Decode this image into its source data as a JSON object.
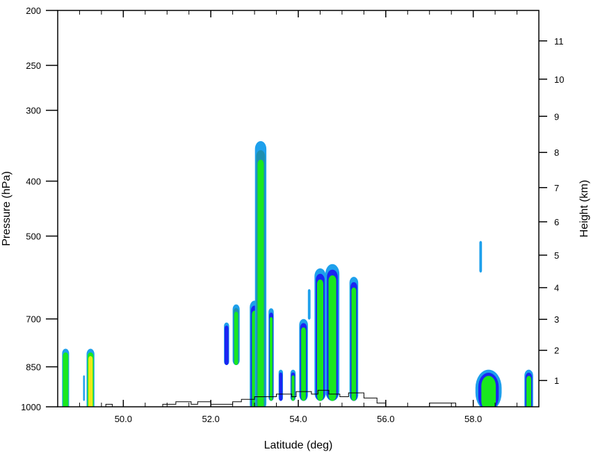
{
  "chart_data": {
    "type": "contour",
    "title": "",
    "xlabel": "Latitude (deg)",
    "ylabel_left": "Pressure (hPa)",
    "ylabel_right": "Height (km)",
    "xlim": [
      48.5,
      59.5
    ],
    "ylim_pressure": [
      1000,
      200
    ],
    "pressure_scale": "log",
    "x_ticks": [
      "50.0",
      "52.0",
      "54.0",
      "56.0",
      "58.0"
    ],
    "x_tick_values": [
      50,
      52,
      54,
      56,
      58
    ],
    "left_ticks": [
      "200",
      "250",
      "300",
      "400",
      "500",
      "700",
      "850",
      "1000"
    ],
    "left_tick_values": [
      200,
      250,
      300,
      400,
      500,
      700,
      850,
      1000
    ],
    "right_ticks": [
      "1",
      "2",
      "3",
      "4",
      "5",
      "6",
      "7",
      "8",
      "9",
      "10",
      "11"
    ],
    "right_tick_values": [
      1,
      2,
      3,
      4,
      5,
      6,
      7,
      8,
      9,
      10,
      11
    ],
    "grid": false,
    "legend": "none",
    "colors": {
      "light_blue": "#1ea0ec",
      "teal": "#1f8fb0",
      "blue": "#1a25f2",
      "green": "#19e81e",
      "yellow": "#f0e81a",
      "terrain": "#000000"
    },
    "cells": [
      {
        "lat": 48.68,
        "p_top": 790,
        "p_bottom": 1000,
        "half_width": 0.08,
        "levels": [
          "light_blue",
          "green"
        ]
      },
      {
        "lat": 49.25,
        "p_top": 790,
        "p_bottom": 1000,
        "half_width": 0.09,
        "levels": [
          "light_blue",
          "green",
          "yellow"
        ]
      },
      {
        "lat": 52.36,
        "p_top": 710,
        "p_bottom": 830,
        "half_width": 0.06,
        "levels": [
          "light_blue",
          "blue"
        ]
      },
      {
        "lat": 52.58,
        "p_top": 660,
        "p_bottom": 830,
        "half_width": 0.08,
        "levels": [
          "light_blue",
          "teal",
          "green"
        ]
      },
      {
        "lat": 53.0,
        "p_top": 650,
        "p_bottom": 1000,
        "half_width": 0.11,
        "levels": [
          "light_blue",
          "blue",
          "green"
        ]
      },
      {
        "lat": 53.14,
        "p_top": 340,
        "p_bottom": 1000,
        "half_width": 0.13,
        "levels": [
          "light_blue",
          "teal",
          "green"
        ]
      },
      {
        "lat": 53.38,
        "p_top": 670,
        "p_bottom": 960,
        "half_width": 0.06,
        "levels": [
          "light_blue",
          "blue",
          "green"
        ]
      },
      {
        "lat": 53.6,
        "p_top": 860,
        "p_bottom": 960,
        "half_width": 0.05,
        "levels": [
          "light_blue",
          "blue"
        ]
      },
      {
        "lat": 53.88,
        "p_top": 860,
        "p_bottom": 960,
        "half_width": 0.06,
        "levels": [
          "light_blue",
          "blue",
          "green"
        ]
      },
      {
        "lat": 54.12,
        "p_top": 700,
        "p_bottom": 960,
        "half_width": 0.1,
        "levels": [
          "light_blue",
          "blue",
          "green"
        ]
      },
      {
        "lat": 54.5,
        "p_top": 570,
        "p_bottom": 960,
        "half_width": 0.13,
        "levels": [
          "light_blue",
          "blue",
          "green"
        ]
      },
      {
        "lat": 54.78,
        "p_top": 560,
        "p_bottom": 960,
        "half_width": 0.16,
        "levels": [
          "light_blue",
          "blue",
          "green"
        ]
      },
      {
        "lat": 55.27,
        "p_top": 590,
        "p_bottom": 960,
        "half_width": 0.1,
        "levels": [
          "light_blue",
          "blue",
          "green"
        ]
      },
      {
        "lat": 58.35,
        "p_top": 860,
        "p_bottom": 1000,
        "half_width": 0.3,
        "levels": [
          "light_blue",
          "blue",
          "green"
        ]
      },
      {
        "lat": 59.27,
        "p_top": 860,
        "p_bottom": 1000,
        "half_width": 0.1,
        "levels": [
          "light_blue",
          "blue",
          "green"
        ]
      },
      {
        "lat": 54.25,
        "p_top": 620,
        "p_bottom": 690,
        "half_width": 0.03,
        "levels": [
          "light_blue"
        ]
      },
      {
        "lat": 58.17,
        "p_top": 510,
        "p_bottom": 570,
        "half_width": 0.03,
        "levels": [
          "light_blue"
        ]
      },
      {
        "lat": 49.1,
        "p_top": 880,
        "p_bottom": 960,
        "half_width": 0.02,
        "levels": [
          "light_blue"
        ]
      }
    ],
    "terrain": [
      [
        48.5,
        1000
      ],
      [
        49.6,
        1000
      ],
      [
        49.6,
        990
      ],
      [
        49.75,
        990
      ],
      [
        49.75,
        1000
      ],
      [
        50.9,
        1000
      ],
      [
        50.9,
        990
      ],
      [
        51.2,
        990
      ],
      [
        51.2,
        980
      ],
      [
        51.55,
        980
      ],
      [
        51.55,
        990
      ],
      [
        51.7,
        990
      ],
      [
        51.7,
        980
      ],
      [
        52.0,
        980
      ],
      [
        52.0,
        990
      ],
      [
        52.5,
        990
      ],
      [
        52.5,
        980
      ],
      [
        52.7,
        980
      ],
      [
        52.7,
        970
      ],
      [
        53.0,
        970
      ],
      [
        53.0,
        960
      ],
      [
        53.5,
        960
      ],
      [
        53.5,
        950
      ],
      [
        53.85,
        950
      ],
      [
        53.85,
        960
      ],
      [
        53.95,
        960
      ],
      [
        53.95,
        940
      ],
      [
        54.3,
        940
      ],
      [
        54.3,
        950
      ],
      [
        54.45,
        950
      ],
      [
        54.45,
        935
      ],
      [
        54.7,
        935
      ],
      [
        54.7,
        950
      ],
      [
        54.95,
        950
      ],
      [
        54.95,
        960
      ],
      [
        55.15,
        960
      ],
      [
        55.15,
        945
      ],
      [
        55.5,
        945
      ],
      [
        55.5,
        965
      ],
      [
        55.8,
        965
      ],
      [
        55.8,
        985
      ],
      [
        56.0,
        985
      ],
      [
        56.0,
        1000
      ],
      [
        57.0,
        1000
      ],
      [
        57.0,
        985
      ],
      [
        57.6,
        985
      ],
      [
        57.6,
        1000
      ],
      [
        59.5,
        1000
      ]
    ]
  }
}
